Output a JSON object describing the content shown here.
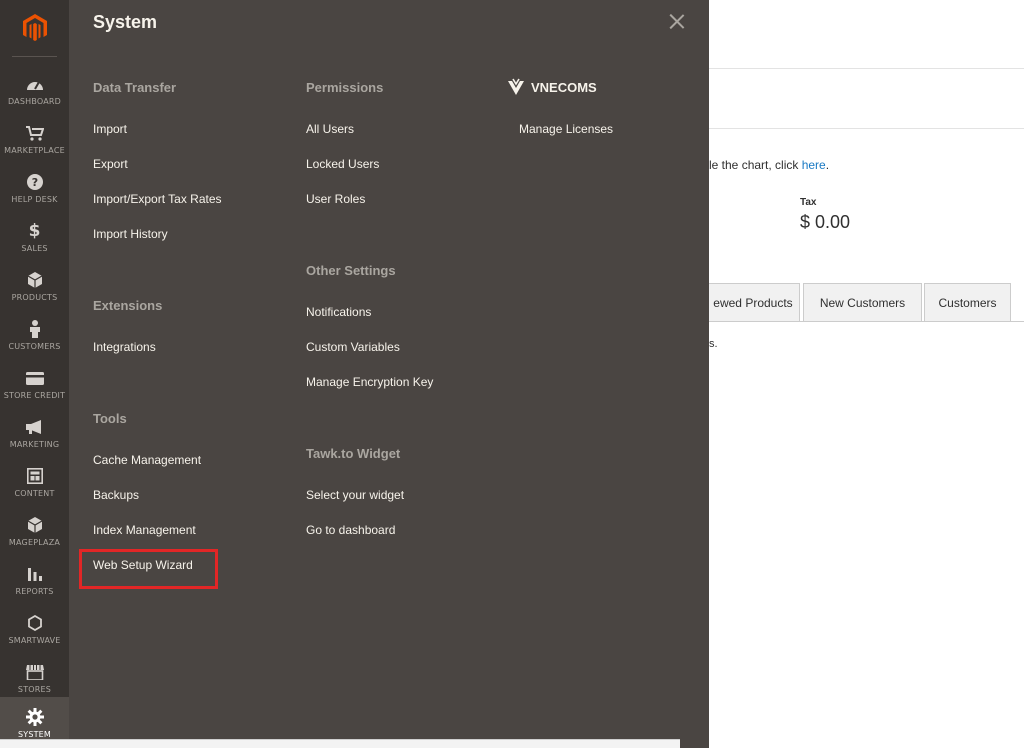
{
  "sidebar": {
    "items": [
      {
        "label": "DASHBOARD",
        "icon": "dashboard-icon"
      },
      {
        "label": "MARKETPLACE",
        "icon": "cart-icon"
      },
      {
        "label": "HELP DESK",
        "icon": "help-icon"
      },
      {
        "label": "SALES",
        "icon": "dollar-icon"
      },
      {
        "label": "PRODUCTS",
        "icon": "cube-icon"
      },
      {
        "label": "CUSTOMERS",
        "icon": "person-icon"
      },
      {
        "label": "STORE CREDIT",
        "icon": "credit-card-icon"
      },
      {
        "label": "MARKETING",
        "icon": "megaphone-icon"
      },
      {
        "label": "CONTENT",
        "icon": "layout-icon"
      },
      {
        "label": "MAGEPLAZA",
        "icon": "cube-icon"
      },
      {
        "label": "REPORTS",
        "icon": "bar-chart-icon"
      },
      {
        "label": "SMARTWAVE",
        "icon": "hexagon-icon"
      },
      {
        "label": "STORES",
        "icon": "store-icon"
      },
      {
        "label": "SYSTEM",
        "icon": "gear-icon"
      }
    ],
    "active": "SYSTEM"
  },
  "panel": {
    "title": "System",
    "data_transfer": {
      "title": "Data Transfer",
      "links": [
        "Import",
        "Export",
        "Import/Export Tax Rates",
        "Import History"
      ]
    },
    "extensions": {
      "title": "Extensions",
      "links": [
        "Integrations"
      ]
    },
    "tools": {
      "title": "Tools",
      "links": [
        "Cache Management",
        "Backups",
        "Index Management",
        "Web Setup Wizard"
      ]
    },
    "permissions": {
      "title": "Permissions",
      "links": [
        "All Users",
        "Locked Users",
        "User Roles"
      ]
    },
    "other_settings": {
      "title": "Other Settings",
      "links": [
        "Notifications",
        "Custom Variables",
        "Manage Encryption Key"
      ]
    },
    "tawk": {
      "title": "Tawk.to Widget",
      "links": [
        "Select your widget",
        "Go to dashboard"
      ]
    },
    "vnecoms": {
      "title": "VNECOMS",
      "links": [
        "Manage Licenses"
      ]
    }
  },
  "background": {
    "chart_text_prefix": "le the chart, click ",
    "chart_link": "here",
    "chart_text_suffix": ".",
    "tax_label": "Tax",
    "tax_value": "$ 0.00",
    "tabs": [
      "ewed Products",
      "New Customers",
      "Customers"
    ],
    "dot_text": "s."
  },
  "colors": {
    "sidebar_bg": "#373330",
    "panel_bg": "#4a4542",
    "logo_orange": "#eb5202",
    "highlight_red": "#e22626",
    "link_blue": "#1979c3"
  }
}
